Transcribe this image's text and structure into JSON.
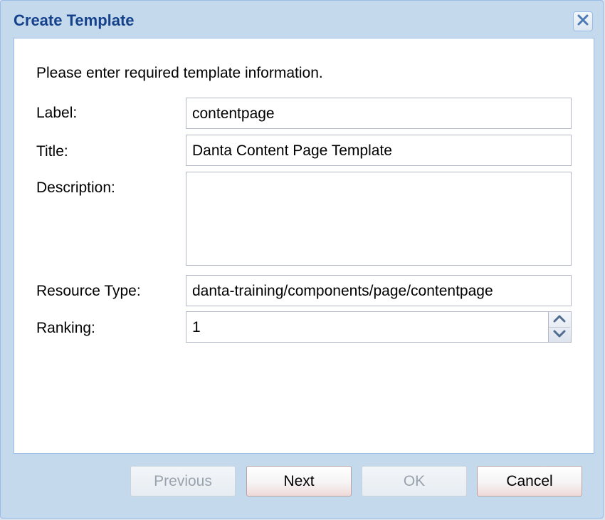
{
  "dialog": {
    "title": "Create Template",
    "intro": "Please enter required template information.",
    "fields": {
      "label": {
        "caption": "Label:",
        "value": "contentpage"
      },
      "title": {
        "caption": "Title:",
        "value": "Danta Content Page Template"
      },
      "description": {
        "caption": "Description:",
        "value": ""
      },
      "resource_type": {
        "caption": "Resource Type:",
        "value": "danta-training/components/page/contentpage"
      },
      "ranking": {
        "caption": "Ranking:",
        "value": "1"
      }
    },
    "buttons": {
      "previous": "Previous",
      "next": "Next",
      "ok": "OK",
      "cancel": "Cancel"
    },
    "icons": {
      "close": "close-icon",
      "spin_up": "chevron-up-icon",
      "spin_down": "chevron-down-icon"
    },
    "colors": {
      "title_text": "#15428b",
      "frame": "#c5d9ec",
      "border": "#99bbe8",
      "disabled_text": "#9aa3ad"
    }
  }
}
